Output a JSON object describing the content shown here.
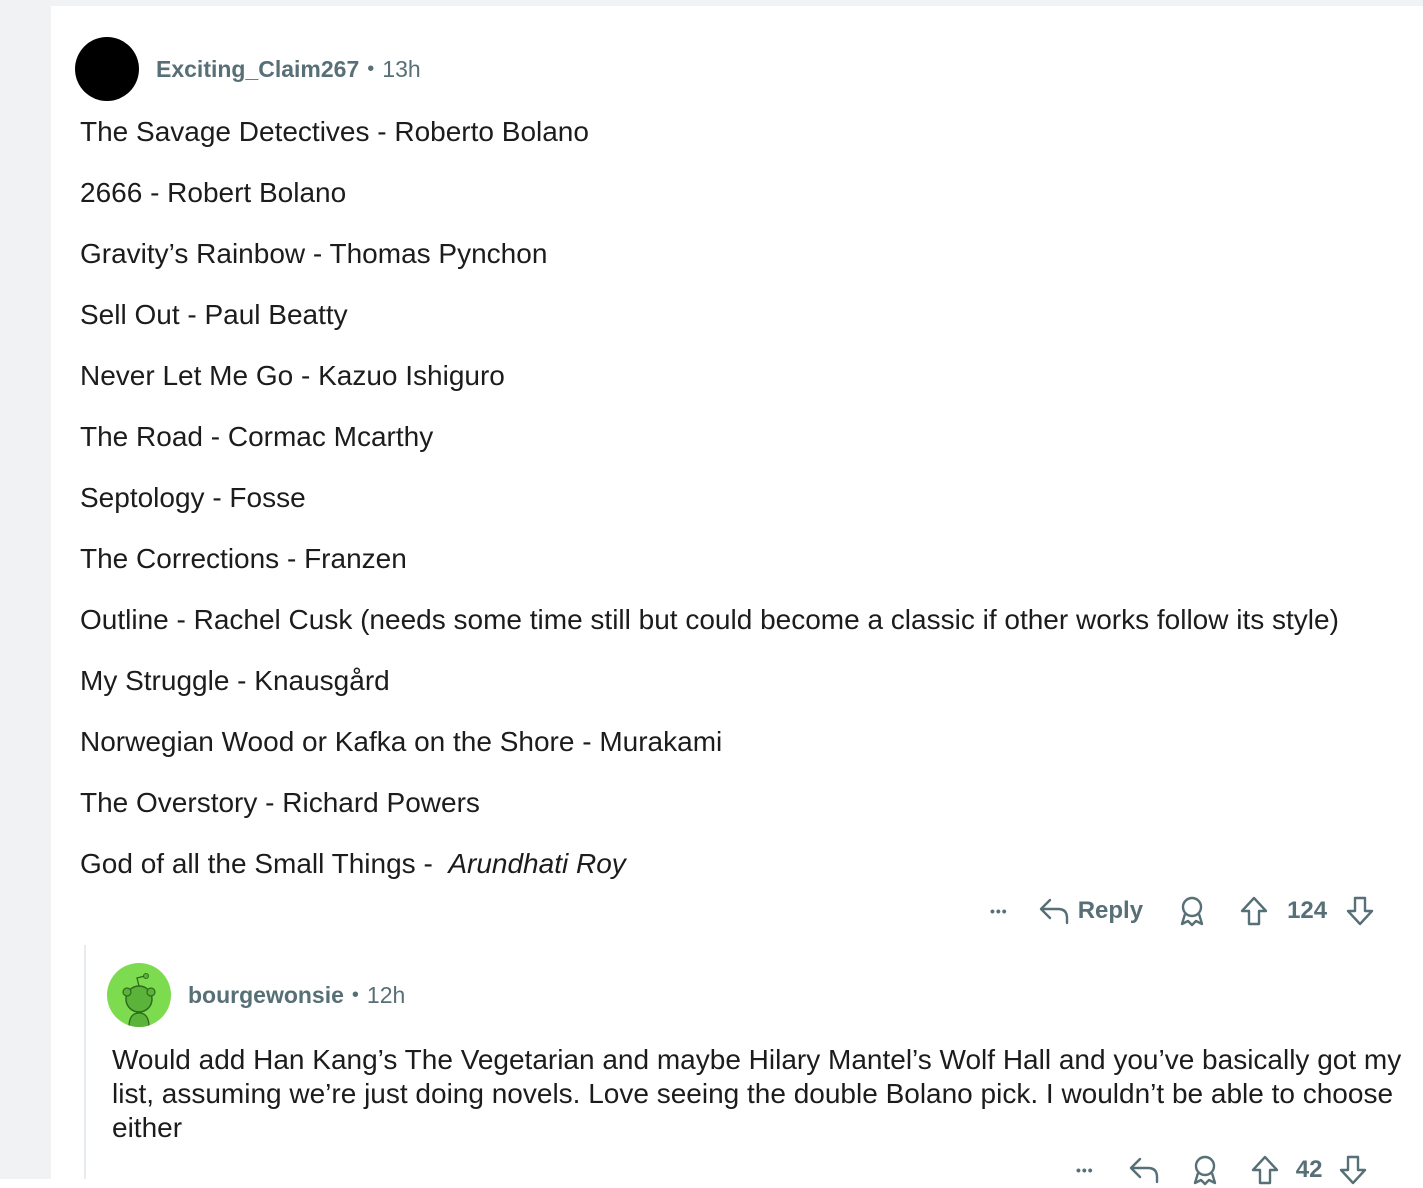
{
  "comment1": {
    "username": "Exciting_Claim267",
    "separator": "•",
    "time": "13h",
    "books": [
      {
        "title": "The Savage Detectives -  Roberto Bolano",
        "italic": ""
      },
      {
        "title": "2666 - Robert Bolano",
        "italic": ""
      },
      {
        "title": "Gravity’s Rainbow - Thomas Pynchon",
        "italic": ""
      },
      {
        "title": "Sell Out - Paul Beatty",
        "italic": ""
      },
      {
        "title": "Never Let Me Go - Kazuo Ishiguro",
        "italic": ""
      },
      {
        "title": "The Road - Cormac Mcarthy",
        "italic": ""
      },
      {
        "title": "Septology - Fosse",
        "italic": ""
      },
      {
        "title": "The Corrections - Franzen",
        "italic": ""
      },
      {
        "title": "Outline - Rachel Cusk (needs some time still but could become a classic if other works follow its style)",
        "italic": ""
      },
      {
        "title": "My Struggle - Knausgård",
        "italic": ""
      },
      {
        "title": "Norwegian Wood or Kafka on the Shore - Murakami",
        "italic": ""
      },
      {
        "title": "The Overstory - Richard Powers",
        "italic": ""
      },
      {
        "title": "God of all the Small Things -  ",
        "italic": "Arundhati Roy"
      }
    ],
    "actions": {
      "more": "•••",
      "reply_label": "Reply",
      "votes": "124"
    }
  },
  "comment2": {
    "username": "bourgewonsie",
    "separator": "•",
    "time": "12h",
    "body": "Would add Han Kang’s The Vegetarian and maybe Hilary Mantel’s Wolf Hall and you’ve basically got my list, assuming we’re just doing novels. Love seeing the double Bolano pick. I wouldn’t be able to choose either",
    "actions": {
      "more": "•••",
      "votes": "42"
    }
  },
  "colors": {
    "meta_text": "#576f76",
    "body_text": "#1c1c1c",
    "avatar_green": "#7ddb4f",
    "gutter": "#f1f2f4"
  }
}
